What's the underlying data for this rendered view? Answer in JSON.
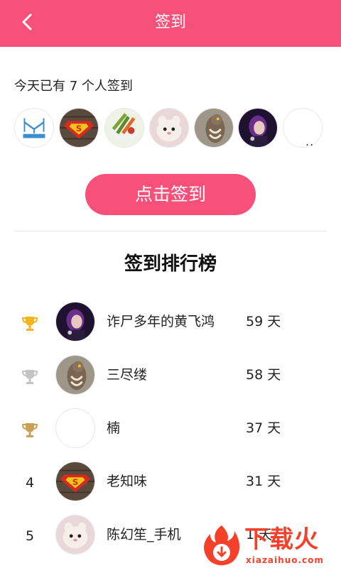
{
  "header": {
    "title": "签到",
    "back_icon": "back-chevron-icon",
    "background_color": "#f7517a"
  },
  "checkin": {
    "count_text": "今天已有 7 个人签到",
    "more_indicator": "..",
    "button_label": "点击签到",
    "button_color": "#f7517a"
  },
  "ranking": {
    "title": "签到排行榜",
    "rows": [
      {
        "rank": "1",
        "badge": "gold-trophy-icon",
        "name": "诈尸多年的黄飞鸿",
        "days": "59 天"
      },
      {
        "rank": "2",
        "badge": "silver-trophy-icon",
        "name": "三尽缕",
        "days": "58 天"
      },
      {
        "rank": "3",
        "badge": "bronze-trophy-icon",
        "name": "楠",
        "days": "37 天"
      },
      {
        "rank": "4",
        "badge": "",
        "name": "老知味",
        "days": "31 天"
      },
      {
        "rank": "5",
        "badge": "",
        "name": "陈幻笙_手机",
        "days": "1 天"
      }
    ]
  },
  "watermark": {
    "text": "下载火",
    "url": "xiazaihuo.com"
  }
}
